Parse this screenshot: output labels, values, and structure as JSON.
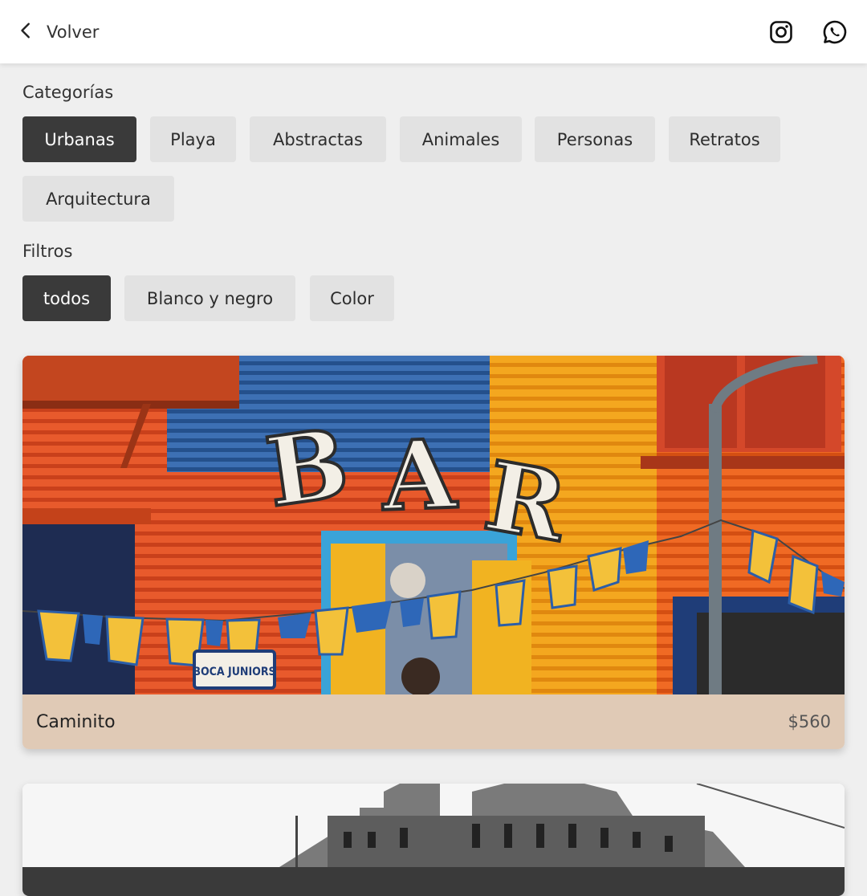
{
  "header": {
    "back_label": "Volver",
    "social": [
      {
        "icon": "instagram-icon"
      },
      {
        "icon": "whatsapp-icon"
      }
    ]
  },
  "categories": {
    "label": "Categorías",
    "items": [
      {
        "label": "Urbanas",
        "active": true
      },
      {
        "label": "Playa",
        "active": false
      },
      {
        "label": "Abstractas",
        "active": false
      },
      {
        "label": "Animales",
        "active": false
      },
      {
        "label": "Personas",
        "active": false
      },
      {
        "label": "Retratos",
        "active": false
      },
      {
        "label": "Arquitectura",
        "active": false
      }
    ]
  },
  "filters": {
    "label": "Filtros",
    "items": [
      {
        "label": "todos",
        "active": true
      },
      {
        "label": "Blanco y negro",
        "active": false
      },
      {
        "label": "Color",
        "active": false
      }
    ]
  },
  "products": [
    {
      "title": "Caminito",
      "price": "$560",
      "photo_sign": "BAR",
      "photo_street_sign": "BOCA JUNIORS"
    },
    {
      "title": "",
      "price": ""
    }
  ],
  "colors": {
    "chip_active": "#3a3a3a",
    "chip": "#e2e2e2",
    "card_footer": "#e0cab6",
    "background": "#efefef"
  }
}
